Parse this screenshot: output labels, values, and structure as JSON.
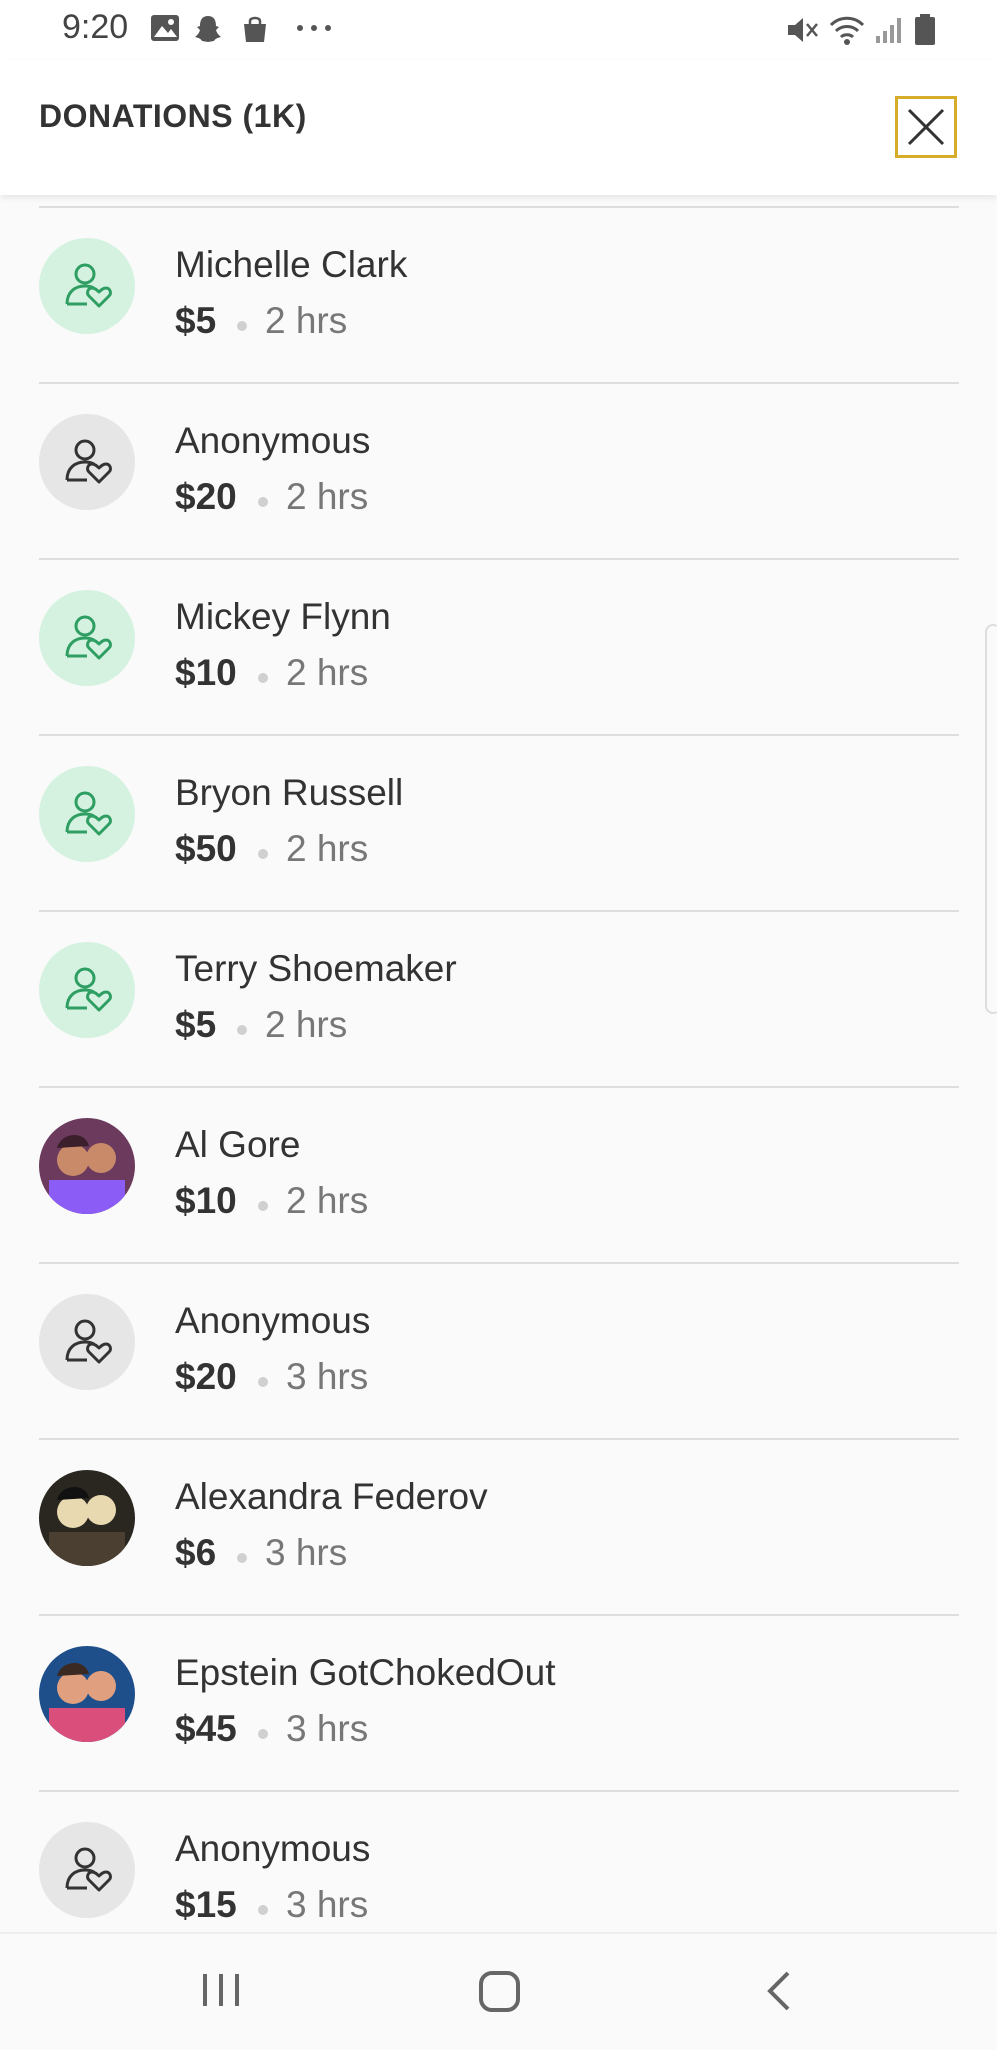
{
  "status_bar": {
    "time": "9:20",
    "icons": [
      "image-icon",
      "snapchat-icon",
      "bag-icon",
      "more-icon",
      "mute-icon",
      "wifi-icon",
      "signal-icon",
      "battery-icon"
    ]
  },
  "header": {
    "title": "DONATIONS (1K)",
    "close_icon": "close-icon",
    "close_border_color": "#d6ad2b"
  },
  "colors": {
    "donor_icon_bg": "#d5f2e1",
    "donor_icon_stroke": "#2f9e63",
    "anonymous_icon_bg": "#e6e6e6",
    "anonymous_icon_stroke": "#333333"
  },
  "donations": [
    {
      "name": "Michelle Clark",
      "amount": "$5",
      "time": "2 hrs",
      "avatar": "green-donor-icon"
    },
    {
      "name": "Anonymous",
      "amount": "$20",
      "time": "2 hrs",
      "avatar": "grey-donor-icon"
    },
    {
      "name": "Mickey Flynn",
      "amount": "$10",
      "time": "2 hrs",
      "avatar": "green-donor-icon"
    },
    {
      "name": "Bryon Russell",
      "amount": "$50",
      "time": "2 hrs",
      "avatar": "green-donor-icon"
    },
    {
      "name": "Terry Shoemaker",
      "amount": "$5",
      "time": "2 hrs",
      "avatar": "green-donor-icon"
    },
    {
      "name": "Al Gore",
      "amount": "$10",
      "time": "2 hrs",
      "avatar": "photo"
    },
    {
      "name": "Anonymous",
      "amount": "$20",
      "time": "3 hrs",
      "avatar": "grey-donor-icon"
    },
    {
      "name": "Alexandra Federov",
      "amount": "$6",
      "time": "3 hrs",
      "avatar": "photo"
    },
    {
      "name": "Epstein GotChokedOut",
      "amount": "$45",
      "time": "3 hrs",
      "avatar": "photo"
    },
    {
      "name": "Anonymous",
      "amount": "$15",
      "time": "3 hrs",
      "avatar": "grey-donor-icon"
    }
  ],
  "nav_bar": {
    "buttons": [
      "recent-apps-icon",
      "home-icon",
      "back-icon"
    ]
  }
}
